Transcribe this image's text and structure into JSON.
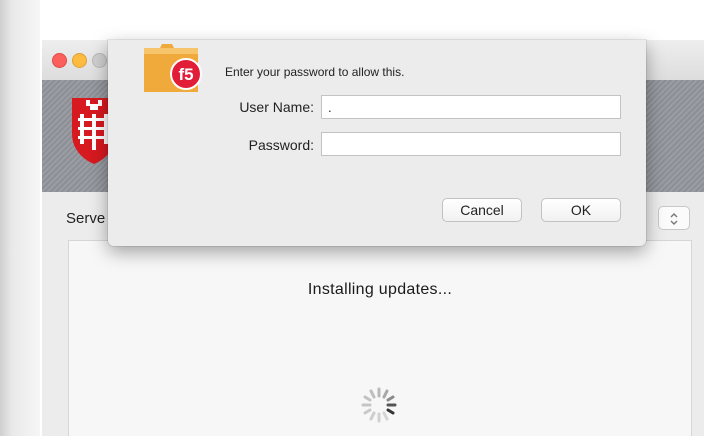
{
  "app": {
    "server_label": "Serve",
    "status": "Installing updates..."
  },
  "dialog": {
    "prompt": "Enter your password to allow this.",
    "username_label": "User Name:",
    "username_value": ".",
    "password_label": "Password:",
    "password_value": "",
    "cancel_label": "Cancel",
    "ok_label": "OK",
    "badge_text": "f5"
  },
  "colors": {
    "close": "#fc605c",
    "minimize": "#fdbc40",
    "crest_red": "#d71920",
    "f5_red": "#e21d38",
    "folder": "#f0a93b"
  },
  "icons": [
    "traffic-light-icons",
    "crest-icon",
    "f5-icon",
    "chevron-updown-icon",
    "spinner-icon"
  ]
}
